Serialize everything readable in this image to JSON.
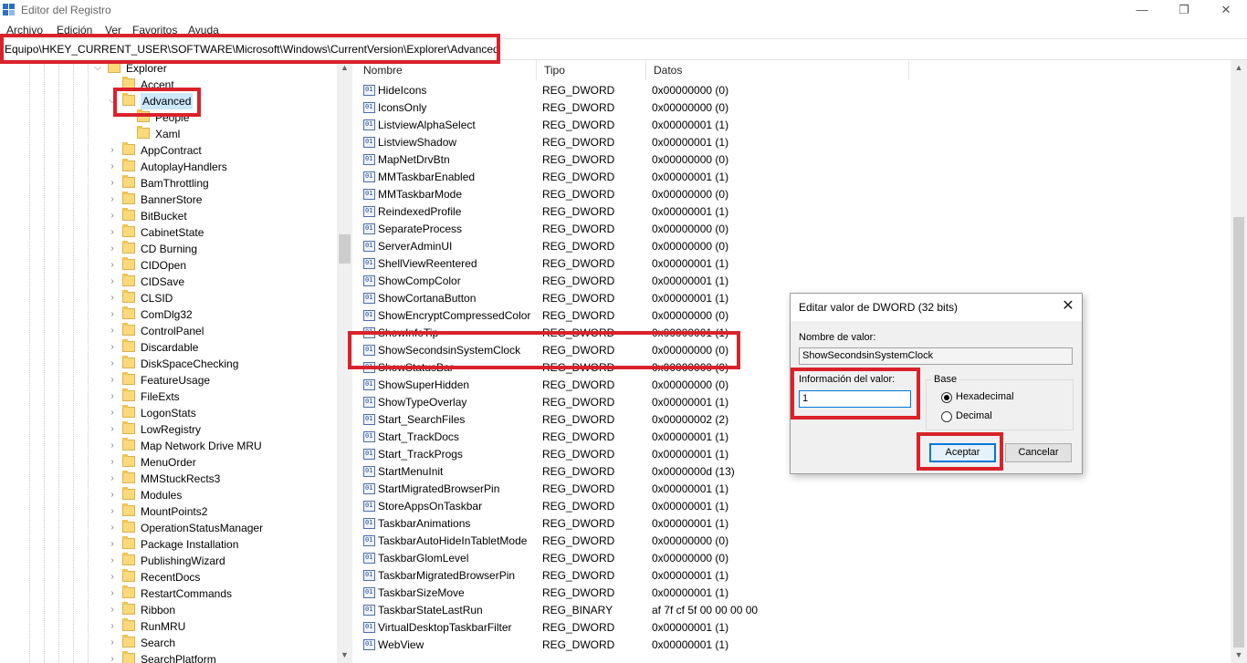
{
  "window": {
    "title": "Editor del Registro",
    "minimize": "—",
    "restore": "❐",
    "close": "✕"
  },
  "menu": [
    "Archivo",
    "Edición",
    "Ver",
    "Favoritos",
    "Ayuda"
  ],
  "address": "Equipo\\HKEY_CURRENT_USER\\SOFTWARE\\Microsoft\\Windows\\CurrentVersion\\Explorer\\Advanced",
  "tree": [
    {
      "label": "Explorer",
      "level": 1,
      "expander": "⌵"
    },
    {
      "label": "Accent",
      "level": 2,
      "expander": ""
    },
    {
      "label": "Advanced",
      "level": 2,
      "expander": "⌵",
      "selected": true
    },
    {
      "label": "People",
      "level": 3,
      "expander": ""
    },
    {
      "label": "Xaml",
      "level": 3,
      "expander": ""
    },
    {
      "label": "AppContract",
      "level": 2,
      "expander": "›"
    },
    {
      "label": "AutoplayHandlers",
      "level": 2,
      "expander": "›"
    },
    {
      "label": "BamThrottling",
      "level": 2,
      "expander": "›"
    },
    {
      "label": "BannerStore",
      "level": 2,
      "expander": "›"
    },
    {
      "label": "BitBucket",
      "level": 2,
      "expander": "›"
    },
    {
      "label": "CabinetState",
      "level": 2,
      "expander": "›"
    },
    {
      "label": "CD Burning",
      "level": 2,
      "expander": "›"
    },
    {
      "label": "CIDOpen",
      "level": 2,
      "expander": "›"
    },
    {
      "label": "CIDSave",
      "level": 2,
      "expander": "›"
    },
    {
      "label": "CLSID",
      "level": 2,
      "expander": "›"
    },
    {
      "label": "ComDlg32",
      "level": 2,
      "expander": "›"
    },
    {
      "label": "ControlPanel",
      "level": 2,
      "expander": "›"
    },
    {
      "label": "Discardable",
      "level": 2,
      "expander": "›"
    },
    {
      "label": "DiskSpaceChecking",
      "level": 2,
      "expander": "›"
    },
    {
      "label": "FeatureUsage",
      "level": 2,
      "expander": "›"
    },
    {
      "label": "FileExts",
      "level": 2,
      "expander": "›"
    },
    {
      "label": "LogonStats",
      "level": 2,
      "expander": "›"
    },
    {
      "label": "LowRegistry",
      "level": 2,
      "expander": "›"
    },
    {
      "label": "Map Network Drive MRU",
      "level": 2,
      "expander": "›"
    },
    {
      "label": "MenuOrder",
      "level": 2,
      "expander": "›"
    },
    {
      "label": "MMStuckRects3",
      "level": 2,
      "expander": "›"
    },
    {
      "label": "Modules",
      "level": 2,
      "expander": "›"
    },
    {
      "label": "MountPoints2",
      "level": 2,
      "expander": "›"
    },
    {
      "label": "OperationStatusManager",
      "level": 2,
      "expander": "›"
    },
    {
      "label": "Package Installation",
      "level": 2,
      "expander": "›"
    },
    {
      "label": "PublishingWizard",
      "level": 2,
      "expander": "›"
    },
    {
      "label": "RecentDocs",
      "level": 2,
      "expander": "›"
    },
    {
      "label": "RestartCommands",
      "level": 2,
      "expander": "›"
    },
    {
      "label": "Ribbon",
      "level": 2,
      "expander": "›"
    },
    {
      "label": "RunMRU",
      "level": 2,
      "expander": "›"
    },
    {
      "label": "Search",
      "level": 2,
      "expander": "›"
    },
    {
      "label": "SearchPlatform",
      "level": 2,
      "expander": "›"
    }
  ],
  "list": {
    "columns": [
      "Nombre",
      "Tipo",
      "Datos"
    ],
    "rows": [
      {
        "name": "HideIcons",
        "type": "REG_DWORD",
        "data": "0x00000000 (0)"
      },
      {
        "name": "IconsOnly",
        "type": "REG_DWORD",
        "data": "0x00000000 (0)"
      },
      {
        "name": "ListviewAlphaSelect",
        "type": "REG_DWORD",
        "data": "0x00000001 (1)"
      },
      {
        "name": "ListviewShadow",
        "type": "REG_DWORD",
        "data": "0x00000001 (1)"
      },
      {
        "name": "MapNetDrvBtn",
        "type": "REG_DWORD",
        "data": "0x00000000 (0)"
      },
      {
        "name": "MMTaskbarEnabled",
        "type": "REG_DWORD",
        "data": "0x00000001 (1)"
      },
      {
        "name": "MMTaskbarMode",
        "type": "REG_DWORD",
        "data": "0x00000000 (0)"
      },
      {
        "name": "ReindexedProfile",
        "type": "REG_DWORD",
        "data": "0x00000001 (1)"
      },
      {
        "name": "SeparateProcess",
        "type": "REG_DWORD",
        "data": "0x00000000 (0)"
      },
      {
        "name": "ServerAdminUI",
        "type": "REG_DWORD",
        "data": "0x00000000 (0)"
      },
      {
        "name": "ShellViewReentered",
        "type": "REG_DWORD",
        "data": "0x00000001 (1)"
      },
      {
        "name": "ShowCompColor",
        "type": "REG_DWORD",
        "data": "0x00000001 (1)"
      },
      {
        "name": "ShowCortanaButton",
        "type": "REG_DWORD",
        "data": "0x00000001 (1)"
      },
      {
        "name": "ShowEncryptCompressedColor",
        "type": "REG_DWORD",
        "data": "0x00000000 (0)"
      },
      {
        "name": "ShowInfoTip",
        "type": "REG_DWORD",
        "data": "0x00000001 (1)"
      },
      {
        "name": "ShowSecondsinSystemClock",
        "type": "REG_DWORD",
        "data": "0x00000000 (0)"
      },
      {
        "name": "ShowStatusBar",
        "type": "REG_DWORD",
        "data": "0x00000000 (0)"
      },
      {
        "name": "ShowSuperHidden",
        "type": "REG_DWORD",
        "data": "0x00000000 (0)"
      },
      {
        "name": "ShowTypeOverlay",
        "type": "REG_DWORD",
        "data": "0x00000001 (1)"
      },
      {
        "name": "Start_SearchFiles",
        "type": "REG_DWORD",
        "data": "0x00000002 (2)"
      },
      {
        "name": "Start_TrackDocs",
        "type": "REG_DWORD",
        "data": "0x00000001 (1)"
      },
      {
        "name": "Start_TrackProgs",
        "type": "REG_DWORD",
        "data": "0x00000001 (1)"
      },
      {
        "name": "StartMenuInit",
        "type": "REG_DWORD",
        "data": "0x0000000d (13)"
      },
      {
        "name": "StartMigratedBrowserPin",
        "type": "REG_DWORD",
        "data": "0x00000001 (1)"
      },
      {
        "name": "StoreAppsOnTaskbar",
        "type": "REG_DWORD",
        "data": "0x00000001 (1)"
      },
      {
        "name": "TaskbarAnimations",
        "type": "REG_DWORD",
        "data": "0x00000001 (1)"
      },
      {
        "name": "TaskbarAutoHideInTabletMode",
        "type": "REG_DWORD",
        "data": "0x00000000 (0)"
      },
      {
        "name": "TaskbarGlomLevel",
        "type": "REG_DWORD",
        "data": "0x00000000 (0)"
      },
      {
        "name": "TaskbarMigratedBrowserPin",
        "type": "REG_DWORD",
        "data": "0x00000001 (1)"
      },
      {
        "name": "TaskbarSizeMove",
        "type": "REG_DWORD",
        "data": "0x00000001 (1)"
      },
      {
        "name": "TaskbarStateLastRun",
        "type": "REG_BINARY",
        "data": "af 7f cf 5f 00 00 00 00"
      },
      {
        "name": "VirtualDesktopTaskbarFilter",
        "type": "REG_DWORD",
        "data": "0x00000001 (1)"
      },
      {
        "name": "WebView",
        "type": "REG_DWORD",
        "data": "0x00000001 (1)"
      }
    ]
  },
  "dialog": {
    "title": "Editar valor de DWORD (32 bits)",
    "close": "✕",
    "name_label": "Nombre de valor:",
    "name_value": "ShowSecondsinSystemClock",
    "data_label": "Información del valor:",
    "data_value": "1",
    "base_label": "Base",
    "hex_label": "Hexadecimal",
    "dec_label": "Decimal",
    "hex_checked": true,
    "ok_label": "Aceptar",
    "cancel_label": "Cancelar"
  },
  "colors": {
    "highlight": "#d9222a",
    "folder": "#fdd97a",
    "selection": "#cce8ff"
  }
}
